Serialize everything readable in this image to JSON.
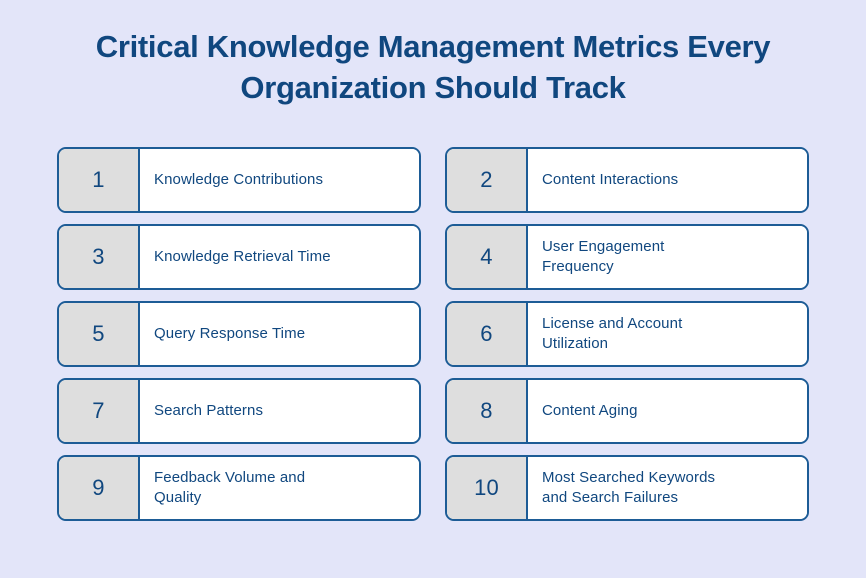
{
  "title": {
    "line1": "Critical Knowledge Management Metrics Every",
    "line2": "Organization Should Track"
  },
  "colors": {
    "background": "#e3e5f9",
    "navy": "#10477f",
    "border": "#1d5c96",
    "number_box": "#dedede",
    "card_background": "#ffffff"
  },
  "metrics": [
    {
      "number": "1",
      "label": "Knowledge Contributions"
    },
    {
      "number": "2",
      "label": "Content Interactions"
    },
    {
      "number": "3",
      "label": "Knowledge Retrieval Time"
    },
    {
      "number": "4",
      "label": "User Engagement\nFrequency"
    },
    {
      "number": "5",
      "label": "Query Response Time"
    },
    {
      "number": "6",
      "label": "License and Account\nUtilization"
    },
    {
      "number": "7",
      "label": "Search Patterns"
    },
    {
      "number": "8",
      "label": "Content Aging"
    },
    {
      "number": "9",
      "label": "Feedback Volume and\nQuality"
    },
    {
      "number": "10",
      "label": "Most Searched Keywords\nand Search Failures"
    }
  ]
}
